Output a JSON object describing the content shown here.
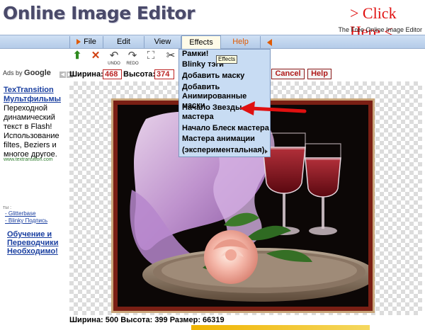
{
  "header": {
    "logo_text": "Online Image Editor",
    "click_here": "> Click Here <",
    "tagline": "The Free Online Image Editor"
  },
  "menu": {
    "file": "File",
    "edit": "Edit",
    "view": "View",
    "effects": "Effects",
    "help": "Help"
  },
  "toolbar": {
    "undo_caption": "UNDO",
    "redo_caption": "REDO"
  },
  "dimensions": {
    "width_label": "Ширина:",
    "width_value": "468",
    "height_label": "Высота:",
    "height_value": "374",
    "cancel_label": "Cancel",
    "help_label": "Help"
  },
  "sidebar": {
    "ads_by": "Ads by",
    "google": "Google",
    "ad_title": "TexTransition Мультфильмы",
    "ad_body": "Переходной динамический текст в Flash! Использование filtes, Beziers и многое другое.",
    "ad_url": "www.textransition.com",
    "links_heading": "ты :",
    "link_glitter": "- Glitterbase",
    "link_blinky": "- Blinky Подпись",
    "ad2_title": "Обучение и Переводчики Необходимо!"
  },
  "dropdown": {
    "items": [
      "Рамки!",
      "Blinky тэги",
      "Добавить маску",
      "Добавить Анимированные маски",
      "Начало Звезды мастера",
      "Начало Блеск мастера",
      "Мастера анимации",
      "(экспериментальная)"
    ],
    "tooltip": "Effects"
  },
  "status": {
    "text": "Ширина: 500 Высота: 399 Размер: 66319"
  },
  "colors": {
    "accent_orange": "#e05a00",
    "click_here_red": "#e01010",
    "menu_blue": "#c8dcf3",
    "frame_red": "#7a1f14"
  }
}
